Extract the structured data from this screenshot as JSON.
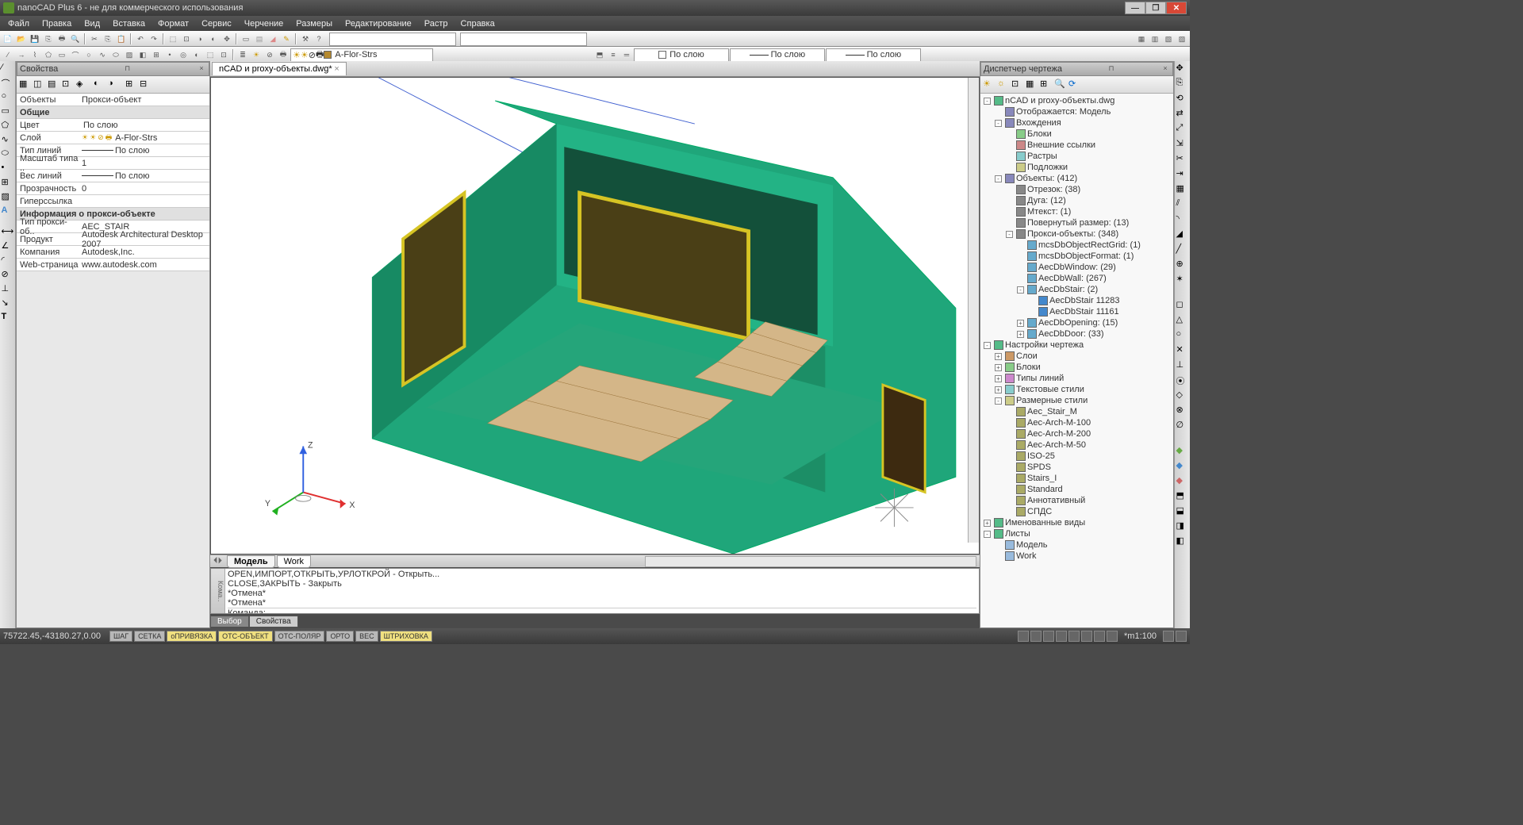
{
  "title": "nanoCAD Plus 6 - не для коммерческого использования",
  "menus": [
    "Файл",
    "Правка",
    "Вид",
    "Вставка",
    "Формат",
    "Сервис",
    "Черчение",
    "Размеры",
    "Редактирование",
    "Растр",
    "Справка"
  ],
  "layer_current": "A-Flor-Strs",
  "style_bylayer": "По слою",
  "doc_tab": "nCAD и proxy-объекты.dwg*",
  "props_panel_title": "Свойства",
  "props_objects_label": "Объекты",
  "props_objects_value": "Прокси-объект",
  "props_group_general": "Общие",
  "props": [
    {
      "k": "Цвет",
      "v": "По слою",
      "swatch": "#fff"
    },
    {
      "k": "Слой",
      "v": "A-Flor-Strs",
      "layer": true
    },
    {
      "k": "Тип линий",
      "v": "По слою",
      "line": true
    },
    {
      "k": "Масштаб типа ..",
      "v": "1"
    },
    {
      "k": "Вес линий",
      "v": "По слою",
      "line": true
    },
    {
      "k": "Прозрачность",
      "v": "0"
    },
    {
      "k": "Гиперссылка",
      "v": ""
    }
  ],
  "props_group_proxy": "Информация о прокси-объекте",
  "props_proxy": [
    {
      "k": "Тип прокси-об..",
      "v": "AEC_STAIR"
    },
    {
      "k": "Продукт",
      "v": "Autodesk Architectural Desktop 2007"
    },
    {
      "k": "Компания",
      "v": "Autodesk,Inc."
    },
    {
      "k": "Web-страница",
      "v": "www.autodesk.com"
    }
  ],
  "model_tab": "Модель",
  "work_tab": "Work",
  "cmd_lines": [
    "OPEN,ИМПОРТ,ОТКРЫТЬ,УРЛОТКРОЙ - Открыть...",
    "CLOSE,ЗАКРЫТЬ - Закрыть",
    "*Отмена*",
    "*Отмена*"
  ],
  "cmd_prompt": "Команда:",
  "bottom_tabs": [
    "Выбор",
    "Свойства"
  ],
  "coords": "75722.45,-43180.27,0.00",
  "status_toggles": [
    "ШАГ",
    "СЕТКА",
    "оПРИВЯЗКА",
    "ОТС-ОБЪЕКТ",
    "ОТС-ПОЛЯР",
    "ОРТО",
    "ВЕС",
    "ШТРИХОВКА"
  ],
  "status_scale": "*m1:100",
  "disp_title": "Диспетчер чертежа",
  "tree": [
    {
      "d": 0,
      "e": "-",
      "i": "#5b8",
      "t": "nCAD и proxy-объекты.dwg"
    },
    {
      "d": 1,
      "e": "",
      "i": "#88b",
      "t": "Отображается: Модель"
    },
    {
      "d": 1,
      "e": "-",
      "i": "#88b",
      "t": "Вхождения"
    },
    {
      "d": 2,
      "e": "",
      "i": "#8c8",
      "t": "Блоки"
    },
    {
      "d": 2,
      "e": "",
      "i": "#c88",
      "t": "Внешние ссылки"
    },
    {
      "d": 2,
      "e": "",
      "i": "#8cc",
      "t": "Растры"
    },
    {
      "d": 2,
      "e": "",
      "i": "#cc8",
      "t": "Подложки"
    },
    {
      "d": 1,
      "e": "-",
      "i": "#88b",
      "t": "Объекты: (412)"
    },
    {
      "d": 2,
      "e": "",
      "i": "#888",
      "t": "Отрезок: (38)"
    },
    {
      "d": 2,
      "e": "",
      "i": "#888",
      "t": "Дуга: (12)"
    },
    {
      "d": 2,
      "e": "",
      "i": "#888",
      "t": "Мтекст: (1)"
    },
    {
      "d": 2,
      "e": "",
      "i": "#888",
      "t": "Повернутый размер: (13)"
    },
    {
      "d": 2,
      "e": "-",
      "i": "#888",
      "t": "Прокси-объекты: (348)"
    },
    {
      "d": 3,
      "e": "",
      "i": "#6ac",
      "t": "mcsDbObjectRectGrid: (1)"
    },
    {
      "d": 3,
      "e": "",
      "i": "#6ac",
      "t": "mcsDbObjectFormat: (1)"
    },
    {
      "d": 3,
      "e": "",
      "i": "#6ac",
      "t": "AecDbWindow: (29)"
    },
    {
      "d": 3,
      "e": "",
      "i": "#6ac",
      "t": "AecDbWall: (267)"
    },
    {
      "d": 3,
      "e": "-",
      "i": "#6ac",
      "t": "AecDbStair: (2)"
    },
    {
      "d": 4,
      "e": "",
      "i": "#48c",
      "t": "AecDbStair 11283"
    },
    {
      "d": 4,
      "e": "",
      "i": "#48c",
      "t": "AecDbStair 11161"
    },
    {
      "d": 3,
      "e": "+",
      "i": "#6ac",
      "t": "AecDbOpening: (15)"
    },
    {
      "d": 3,
      "e": "+",
      "i": "#6ac",
      "t": "AecDbDoor: (33)"
    },
    {
      "d": 0,
      "e": "-",
      "i": "#5b8",
      "t": "Настройки чертежа"
    },
    {
      "d": 1,
      "e": "+",
      "i": "#c96",
      "t": "Слои"
    },
    {
      "d": 1,
      "e": "+",
      "i": "#8c8",
      "t": "Блоки"
    },
    {
      "d": 1,
      "e": "+",
      "i": "#c8c",
      "t": "Типы линий"
    },
    {
      "d": 1,
      "e": "+",
      "i": "#8cc",
      "t": "Текстовые стили"
    },
    {
      "d": 1,
      "e": "-",
      "i": "#cc8",
      "t": "Размерные стили"
    },
    {
      "d": 2,
      "e": "",
      "i": "#aa6",
      "t": "Aec_Stair_M"
    },
    {
      "d": 2,
      "e": "",
      "i": "#aa6",
      "t": "Aec-Arch-M-100"
    },
    {
      "d": 2,
      "e": "",
      "i": "#aa6",
      "t": "Aec-Arch-M-200"
    },
    {
      "d": 2,
      "e": "",
      "i": "#aa6",
      "t": "Aec-Arch-M-50"
    },
    {
      "d": 2,
      "e": "",
      "i": "#aa6",
      "t": "ISO-25"
    },
    {
      "d": 2,
      "e": "",
      "i": "#aa6",
      "t": "SPDS"
    },
    {
      "d": 2,
      "e": "",
      "i": "#aa6",
      "t": "Stairs_I"
    },
    {
      "d": 2,
      "e": "",
      "i": "#aa6",
      "t": "Standard"
    },
    {
      "d": 2,
      "e": "",
      "i": "#aa6",
      "t": "Аннотативный"
    },
    {
      "d": 2,
      "e": "",
      "i": "#aa6",
      "t": "СПДС"
    },
    {
      "d": 0,
      "e": "+",
      "i": "#5b8",
      "t": "Именованные виды"
    },
    {
      "d": 0,
      "e": "-",
      "i": "#5b8",
      "t": "Листы"
    },
    {
      "d": 1,
      "e": "",
      "i": "#9bd",
      "t": "Модель"
    },
    {
      "d": 1,
      "e": "",
      "i": "#9bd",
      "t": "Work"
    }
  ]
}
